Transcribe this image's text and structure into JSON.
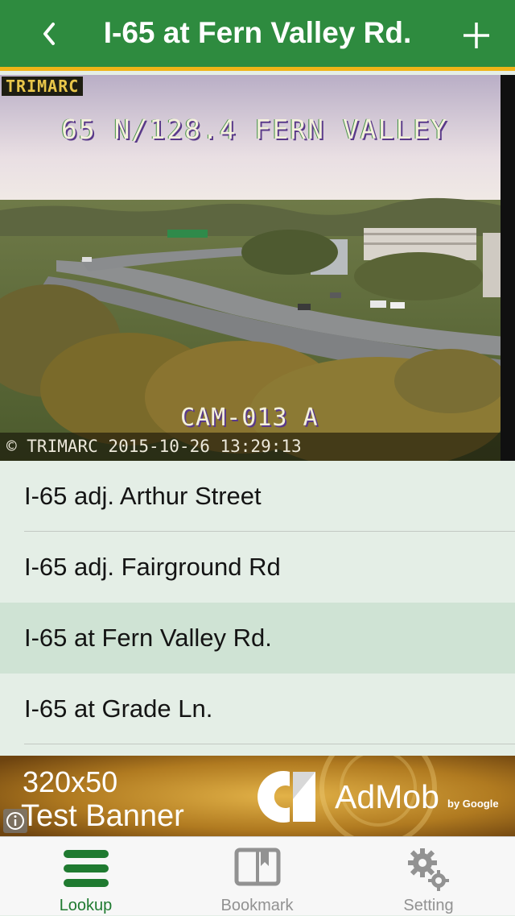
{
  "nav": {
    "title": "I-65 at Fern Valley Rd.",
    "back_icon": "chevron-left-icon",
    "add_icon": "plus-icon",
    "bar_color": "#2e8b3f",
    "accent_color": "#f0b418"
  },
  "camera": {
    "badge": "TRIMARC",
    "header": "65 N/128.4  FERN VALLEY",
    "cam_id": "CAM-013 A",
    "stamp": "© TRIMARC 2015-10-26 13:29:13"
  },
  "list": {
    "items": [
      {
        "label": "I-65 adj. Arthur Street",
        "selected": false
      },
      {
        "label": "I-65 adj. Fairground Rd",
        "selected": false
      },
      {
        "label": "I-65 at Fern Valley Rd.",
        "selected": true
      },
      {
        "label": "I-65 at Grade Ln.",
        "selected": false
      }
    ]
  },
  "ad": {
    "line1": "320x50",
    "line2": "Test Banner",
    "brand": "AdMob",
    "by": "by Google",
    "info_icon": "info-icon"
  },
  "tabs": [
    {
      "label": "Lookup",
      "icon": "list-icon",
      "active": true
    },
    {
      "label": "Bookmark",
      "icon": "book-icon",
      "active": false
    },
    {
      "label": "Setting",
      "icon": "gears-icon",
      "active": false
    }
  ]
}
